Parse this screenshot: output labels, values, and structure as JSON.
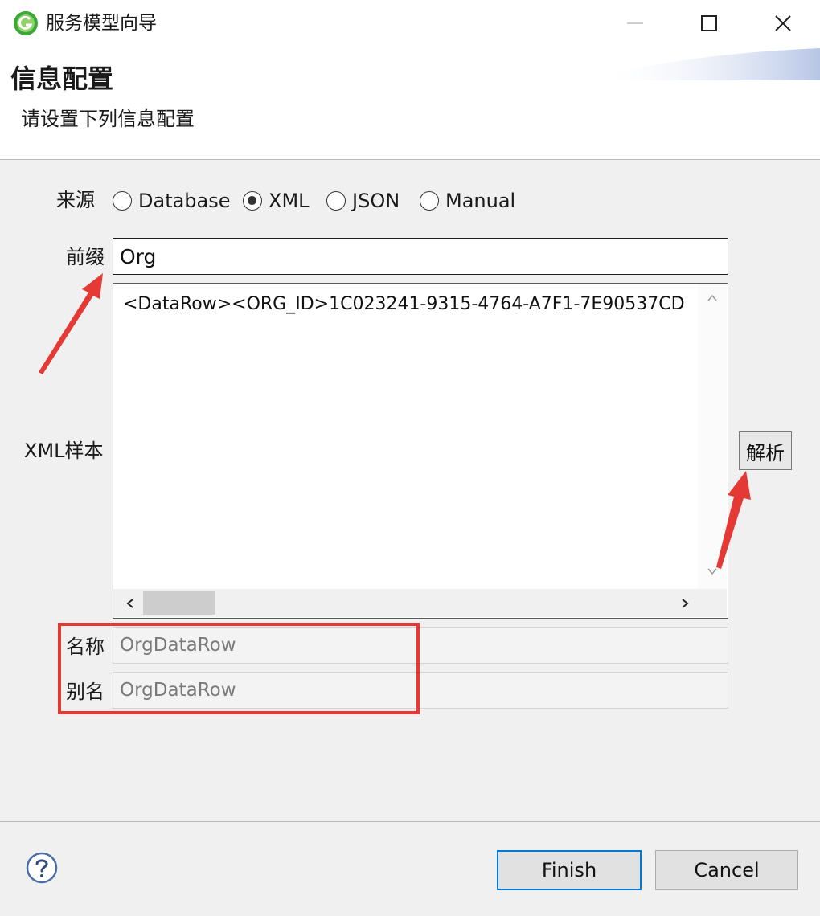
{
  "window": {
    "title": "服务模型向导"
  },
  "header": {
    "title": "信息配置",
    "subtitle": "请设置下列信息配置"
  },
  "source": {
    "label": "来源",
    "options": [
      "Database",
      "XML",
      "JSON",
      "Manual"
    ],
    "selected": "XML"
  },
  "prefix": {
    "label": "前缀",
    "value": "Org"
  },
  "xml_sample": {
    "label": "XML样本",
    "text": "<DataRow><ORG_ID>1C023241-9315-4764-A7F1-7E90537CD"
  },
  "parse_button": {
    "label": "解析"
  },
  "name": {
    "label": "名称",
    "value": "OrgDataRow"
  },
  "alias": {
    "label": "别名",
    "value": "OrgDataRow"
  },
  "footer": {
    "finish_label": "Finish",
    "cancel_label": "Cancel"
  },
  "colors": {
    "highlight": "#e53935",
    "primary_button_border": "#0078d7",
    "app_icon_green": "#3aa935",
    "help_icon_blue": "#4a6fa5"
  },
  "icons": [
    "app-icon",
    "minimize-icon",
    "maximize-icon",
    "close-icon",
    "help-icon",
    "chevron-up-icon",
    "chevron-down-icon",
    "chevron-left-icon",
    "chevron-right-icon"
  ]
}
